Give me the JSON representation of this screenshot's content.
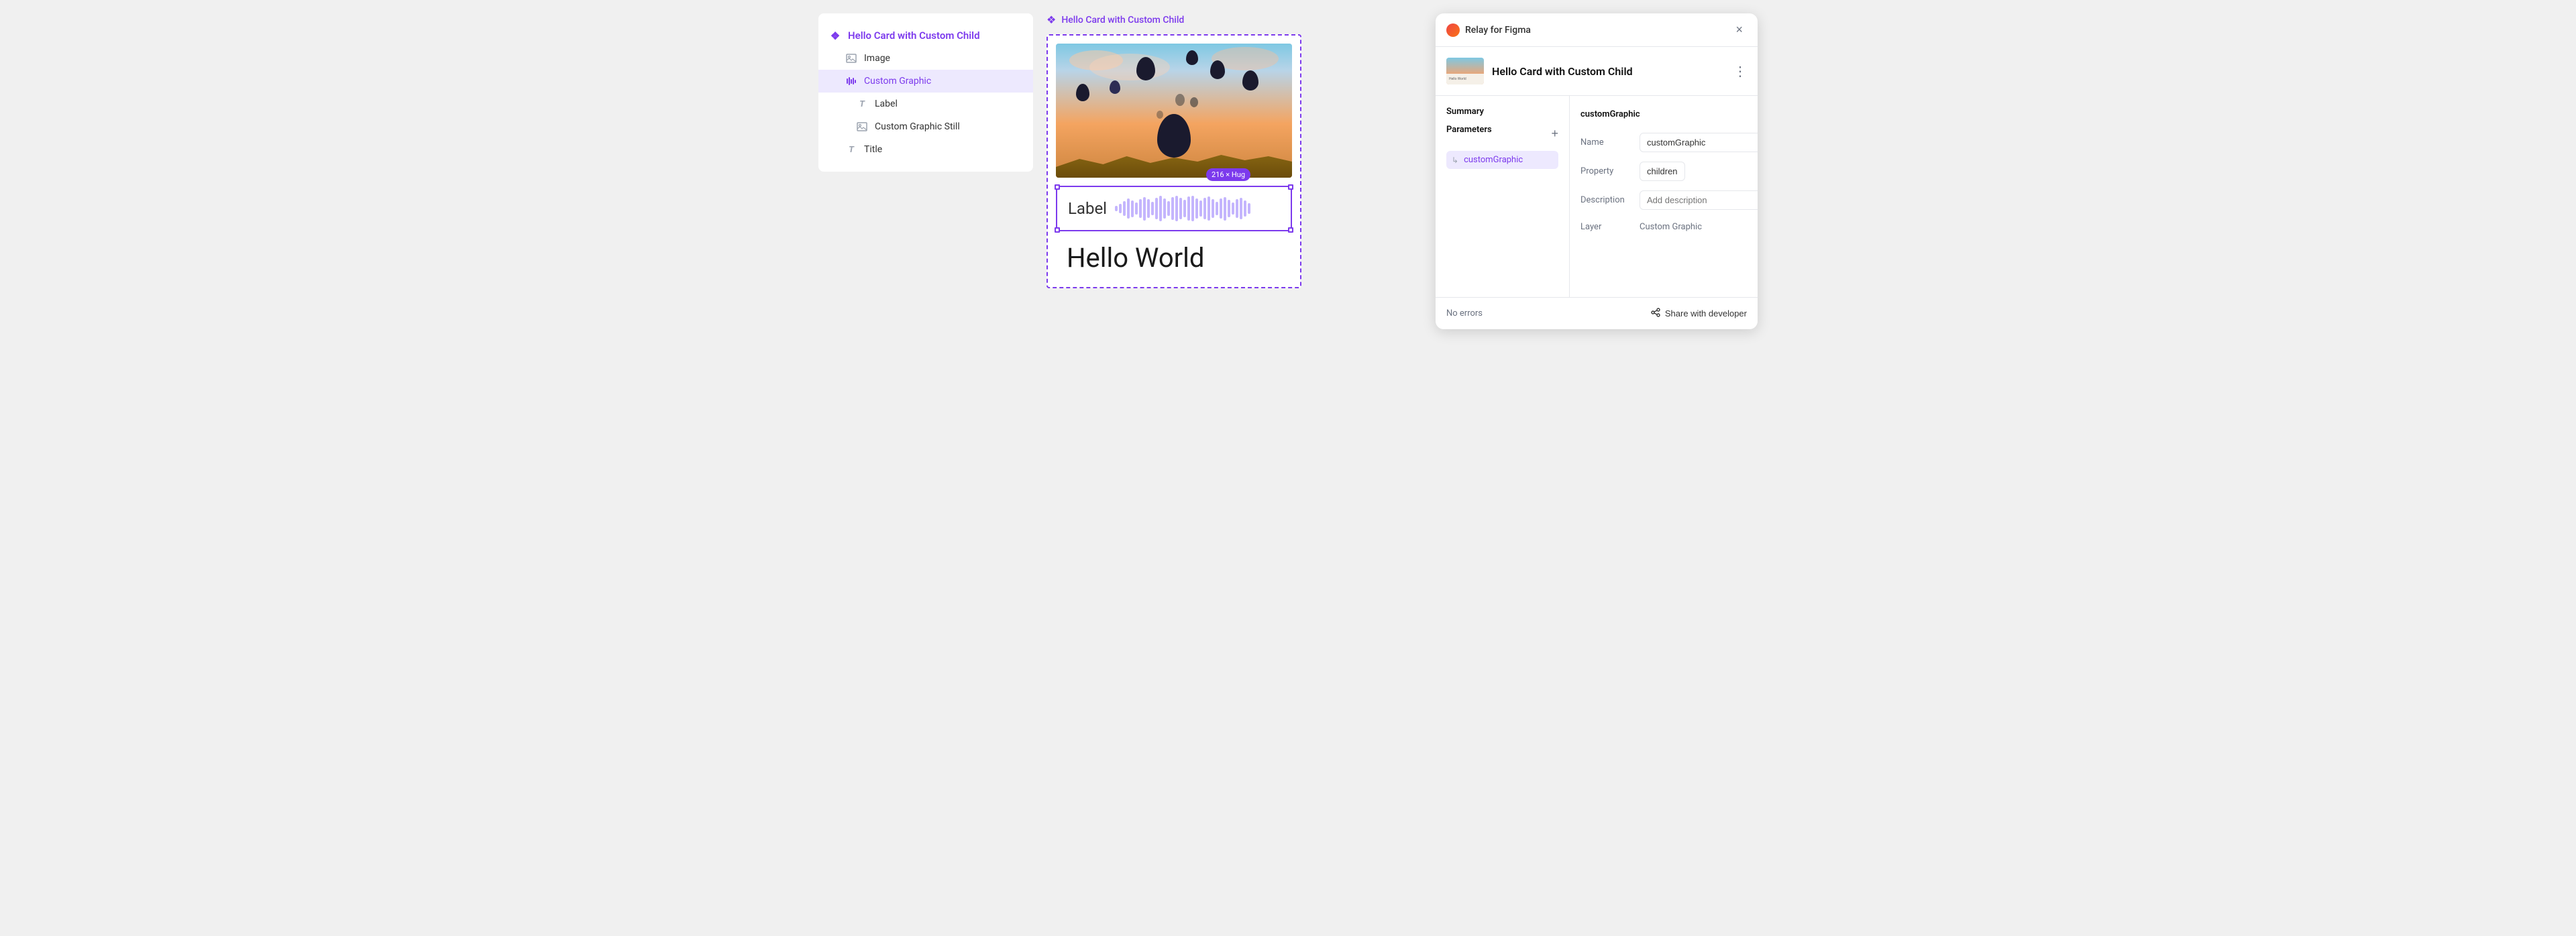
{
  "leftPanel": {
    "items": [
      {
        "id": "root",
        "label": "Hello Card with Custom Child",
        "icon": "grid",
        "indent": 0,
        "selected": false
      },
      {
        "id": "image",
        "label": "Image",
        "icon": "image",
        "indent": 1,
        "selected": false
      },
      {
        "id": "custom-graphic",
        "label": "Custom Graphic",
        "icon": "bars",
        "indent": 1,
        "selected": true
      },
      {
        "id": "label",
        "label": "Label",
        "icon": "T",
        "indent": 2,
        "selected": false
      },
      {
        "id": "custom-graphic-still",
        "label": "Custom Graphic Still",
        "icon": "image",
        "indent": 2,
        "selected": false
      },
      {
        "id": "title",
        "label": "Title",
        "icon": "T",
        "indent": 1,
        "selected": false
      }
    ]
  },
  "canvas": {
    "frameTitle": "Hello Card with Custom Child",
    "labelText": "Label",
    "sizeBadge": "216 × Hug",
    "helloWorldText": "Hello World"
  },
  "relay": {
    "appName": "Relay for Figma",
    "closeLabel": "×",
    "componentName": "Hello Card with Custom Child",
    "moreLabel": "⋮",
    "summaryLabel": "Summary",
    "parametersLabel": "Parameters",
    "addLabel": "+",
    "paramItem": "customGraphic",
    "fields": {
      "nameLabel": "Name",
      "nameValue": "customGraphic",
      "propertyLabel": "Property",
      "propertyValue": "children",
      "descriptionLabel": "Description",
      "descriptionPlaceholder": "Add description",
      "layerLabel": "Layer",
      "layerValue": "Custom Graphic"
    },
    "deleteLabel": "🗑",
    "footerNoErrors": "No errors",
    "shareLabel": "Share with developer"
  },
  "waveform": {
    "bars": [
      8,
      14,
      22,
      30,
      25,
      18,
      28,
      35,
      28,
      20,
      32,
      38,
      30,
      22,
      34,
      38,
      32,
      26,
      36,
      38,
      30,
      24,
      32,
      36,
      28,
      20,
      30,
      35,
      26,
      18,
      28,
      32,
      24,
      16
    ]
  }
}
